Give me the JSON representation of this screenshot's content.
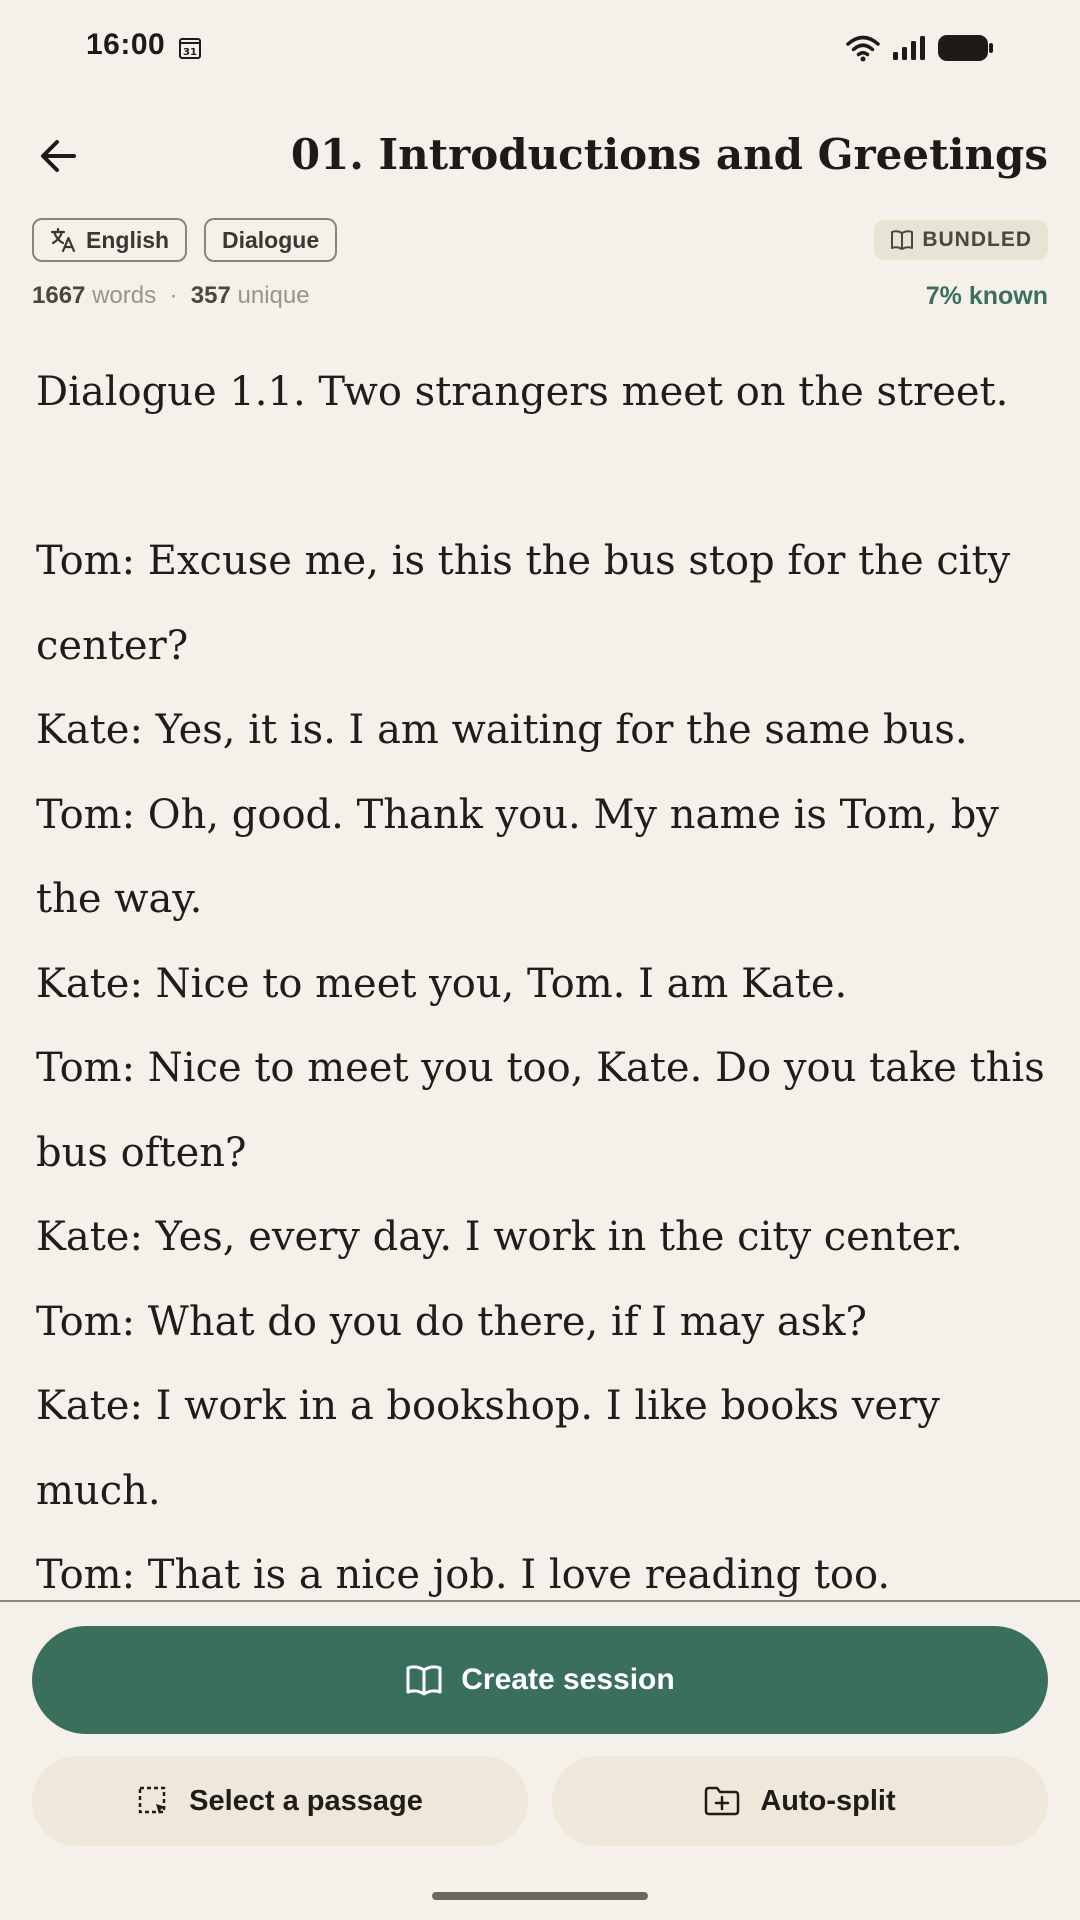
{
  "status_bar": {
    "time": "16:00",
    "calendar_day": "31"
  },
  "header": {
    "title": "01. Introductions and Greetings"
  },
  "tags": {
    "language": "English",
    "type": "Dialogue",
    "bundled": "BUNDLED"
  },
  "stats": {
    "words_count": "1667",
    "words_label": "words",
    "separator": "·",
    "unique_count": "357",
    "unique_label": "unique",
    "known": "7% known"
  },
  "text": {
    "lines": [
      "Dialogue 1.1. Two strangers meet on the street.",
      "",
      "Tom: Excuse me, is this the bus stop for the city center?",
      "Kate: Yes, it is. I am waiting for the same bus.",
      "Tom: Oh, good. Thank you. My name is Tom, by the way.",
      "Kate: Nice to meet you, Tom. I am Kate.",
      "Tom: Nice to meet you too, Kate. Do you take this bus often?",
      "Kate: Yes, every day. I work in the city center.",
      "Tom: What do you do there, if I may ask?",
      "Kate: I work in a bookshop. I like books very much.",
      "Tom: That is a nice job. I love reading too."
    ]
  },
  "actions": {
    "create_session": "Create session",
    "select_passage": "Select a passage",
    "auto_split": "Auto-split"
  },
  "colors": {
    "background": "#f5f1ea",
    "primary": "#3a6f5b",
    "known": "#3d6f5c",
    "secondary_button": "#efe7d9"
  }
}
